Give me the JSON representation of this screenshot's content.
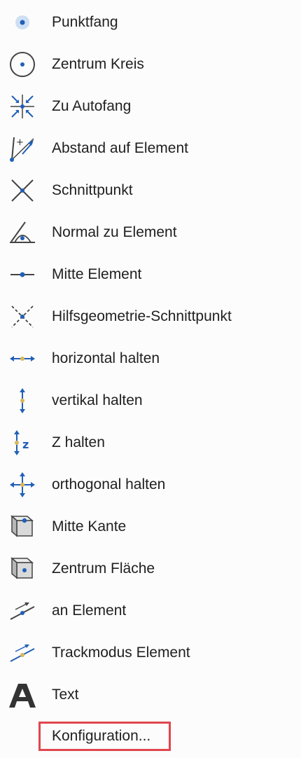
{
  "menu": {
    "items": [
      {
        "label": "Punktfang",
        "icon": "point-snap-icon"
      },
      {
        "label": "Zentrum Kreis",
        "icon": "circle-center-icon"
      },
      {
        "label": "Zu Autofang",
        "icon": "auto-snap-icon"
      },
      {
        "label": "Abstand auf Element",
        "icon": "distance-on-element-icon"
      },
      {
        "label": "Schnittpunkt",
        "icon": "intersection-icon"
      },
      {
        "label": "Normal zu Element",
        "icon": "normal-to-element-icon"
      },
      {
        "label": "Mitte Element",
        "icon": "element-midpoint-icon"
      },
      {
        "label": "Hilfsgeometrie-Schnittpunkt",
        "icon": "construction-intersection-icon"
      },
      {
        "label": "horizontal halten",
        "icon": "hold-horizontal-icon"
      },
      {
        "label": "vertikal halten",
        "icon": "hold-vertical-icon"
      },
      {
        "label": "Z halten",
        "icon": "hold-z-icon"
      },
      {
        "label": "orthogonal halten",
        "icon": "hold-orthogonal-icon"
      },
      {
        "label": "Mitte Kante",
        "icon": "edge-midpoint-icon"
      },
      {
        "label": "Zentrum Fläche",
        "icon": "face-center-icon"
      },
      {
        "label": "an Element",
        "icon": "on-element-icon"
      },
      {
        "label": "Trackmodus Element",
        "icon": "track-mode-element-icon"
      },
      {
        "label": "Text",
        "icon": "text-icon"
      }
    ],
    "config_label": "Konfiguration..."
  },
  "colors": {
    "blue": "#2160b8",
    "gray": "#444444",
    "yellow": "#d8b85a",
    "highlight": "#e0464e"
  }
}
